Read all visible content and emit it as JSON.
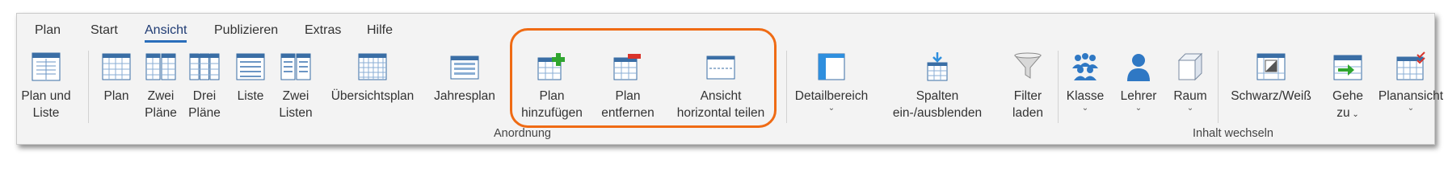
{
  "tabs": [
    "Plan",
    "Start",
    "Ansicht",
    "Publizieren",
    "Extras",
    "Hilfe"
  ],
  "active_tab": "Ansicht",
  "buttons": {
    "plan_und_liste": [
      "Plan und",
      "Liste"
    ],
    "plan": [
      "Plan"
    ],
    "zwei_plaene": [
      "Zwei",
      "Pläne"
    ],
    "drei_plaene": [
      "Drei",
      "Pläne"
    ],
    "liste": [
      "Liste"
    ],
    "zwei_listen": [
      "Zwei",
      "Listen"
    ],
    "uebersichtsplan": [
      "Übersichtsplan"
    ],
    "jahresplan": [
      "Jahresplan"
    ],
    "plan_hinzufuegen": [
      "Plan",
      "hinzufügen"
    ],
    "plan_entfernen": [
      "Plan",
      "entfernen"
    ],
    "ansicht_teilen": [
      "Ansicht",
      "horizontal teilen"
    ],
    "detailbereich": [
      "Detailbereich"
    ],
    "spalten": [
      "Spalten",
      "ein-/ausblenden"
    ],
    "filter_laden": [
      "Filter",
      "laden"
    ],
    "klasse": [
      "Klasse"
    ],
    "lehrer": [
      "Lehrer"
    ],
    "raum": [
      "Raum"
    ],
    "schwarz_weiss": [
      "Schwarz/Weiß"
    ],
    "gehe_zu": [
      "Gehe",
      "zu"
    ],
    "planansicht": [
      "Planansicht"
    ]
  },
  "groups": {
    "anordnung": "Anordnung",
    "inhalt_wechseln": "Inhalt wechseln"
  },
  "colors": {
    "highlight": "#ef6b14",
    "accent": "#2a6ebb",
    "add": "#2fa52f",
    "remove": "#d9342b"
  }
}
